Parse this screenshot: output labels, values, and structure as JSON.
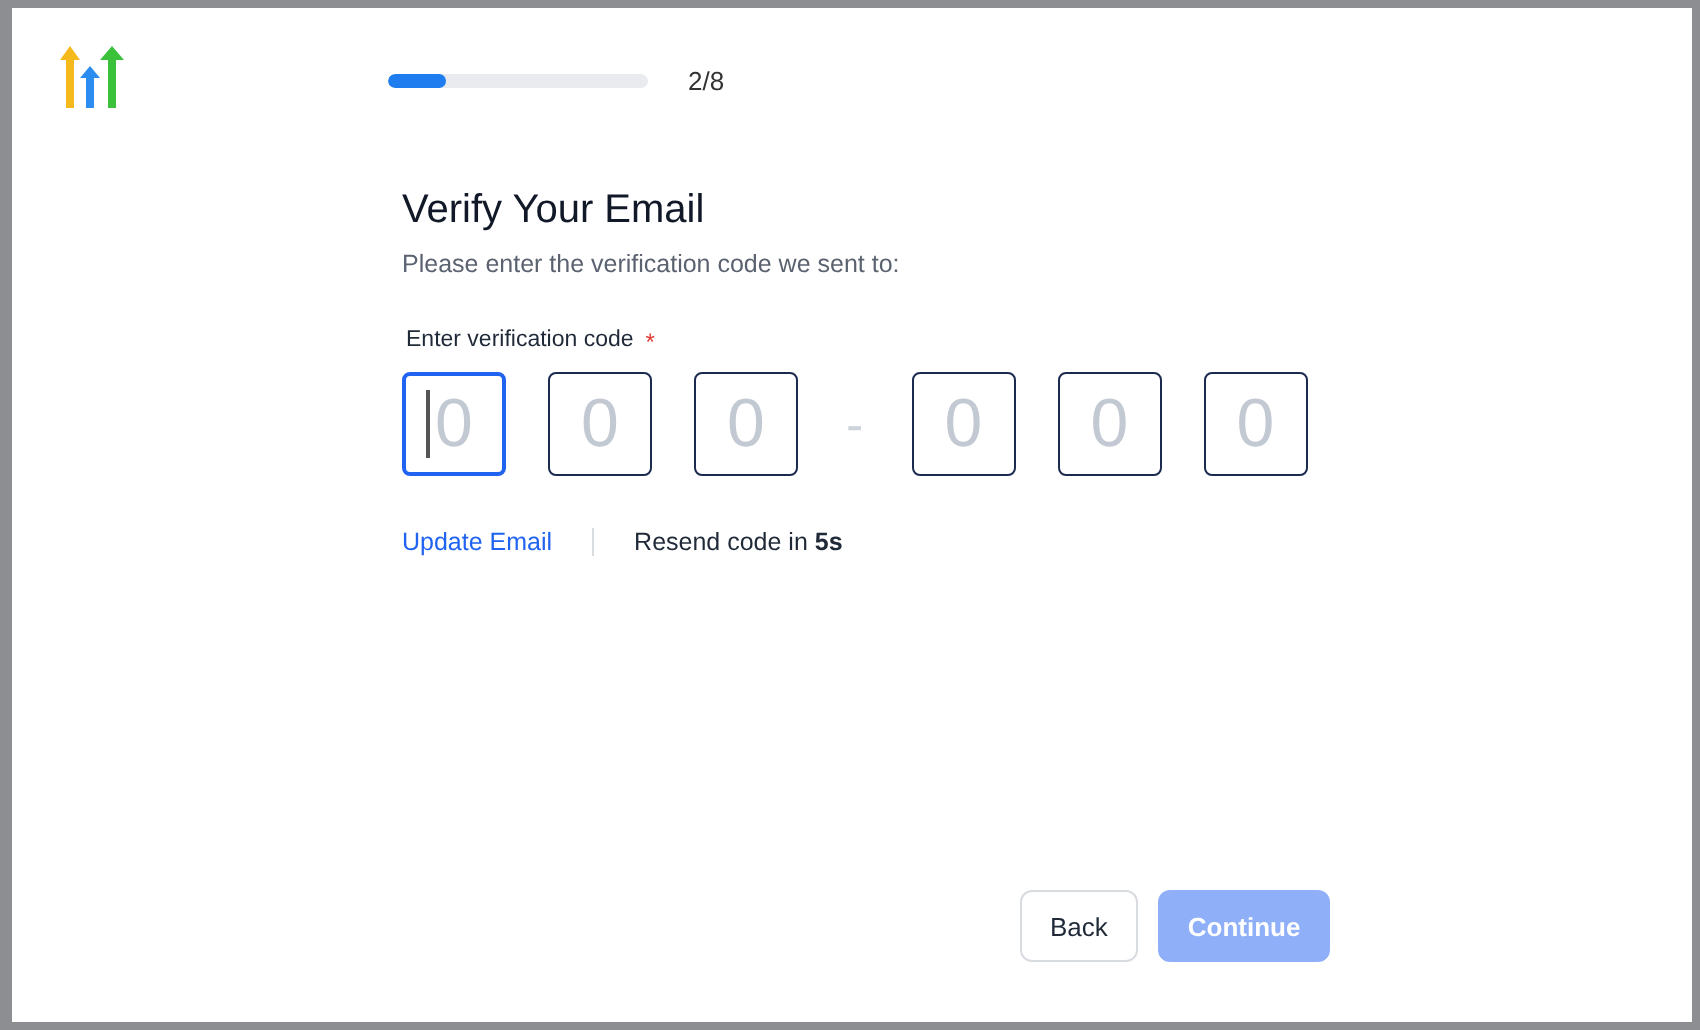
{
  "progress": {
    "level": 0.22,
    "step": "2/8"
  },
  "heading": "Verify Your Email",
  "subtitle": "Please enter the verification code we sent to:",
  "code": {
    "label": "Enter verification code",
    "required_mark": "*",
    "separator": "-",
    "groups": [
      [
        {
          "placeholder": "0",
          "focused": true
        },
        {
          "placeholder": "0",
          "focused": false
        },
        {
          "placeholder": "0",
          "focused": false
        }
      ],
      [
        {
          "placeholder": "0",
          "focused": false
        },
        {
          "placeholder": "0",
          "focused": false
        },
        {
          "placeholder": "0",
          "focused": false
        }
      ]
    ]
  },
  "update_link": "Update Email",
  "resend": "Resend code in **5s**",
  "buttons": [
    {
      "label": "Back",
      "kind": "secondary",
      "disabled": false
    },
    {
      "label": "Continue",
      "kind": "primary",
      "disabled": true
    }
  ]
}
